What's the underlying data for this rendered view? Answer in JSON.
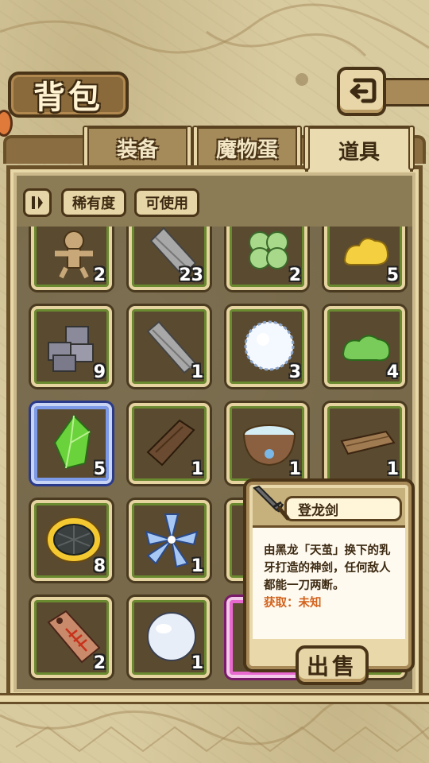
{
  "header": {
    "title": "背包"
  },
  "tabs": [
    {
      "label": "装备",
      "active": false
    },
    {
      "label": "魔物蛋",
      "active": false
    },
    {
      "label": "道具",
      "active": true
    }
  ],
  "filters": {
    "sort_icon": "sort-icon",
    "rarity_label": "稀有度",
    "usable_label": "可使用"
  },
  "items": [
    {
      "icon": "voodoo-doll-icon",
      "count": "2"
    },
    {
      "icon": "stone-slab-icon",
      "count": "23"
    },
    {
      "icon": "four-leaf-clover-icon",
      "count": "2"
    },
    {
      "icon": "gold-nugget-icon",
      "count": "5"
    },
    {
      "icon": "stone-blocks-icon",
      "count": "9"
    },
    {
      "icon": "stone-slab-icon",
      "count": "1"
    },
    {
      "icon": "snowball-icon",
      "count": "3"
    },
    {
      "icon": "green-slime-icon",
      "count": "4"
    },
    {
      "icon": "green-crystal-icon",
      "count": "5"
    },
    {
      "icon": "wood-plank-dark-icon",
      "count": "1"
    },
    {
      "icon": "water-bowl-icon",
      "count": "1"
    },
    {
      "icon": "wood-plank-light-icon",
      "count": "1"
    },
    {
      "icon": "woven-nest-icon",
      "count": "8"
    },
    {
      "icon": "ice-flower-icon",
      "count": "1"
    },
    {
      "icon": "blue-item-icon",
      "count": ""
    },
    {
      "icon": "empty",
      "count": ""
    },
    {
      "icon": "fossil-tag-icon",
      "count": "2"
    },
    {
      "icon": "pearl-icon",
      "count": "1"
    },
    {
      "icon": "sword-item-icon",
      "count": ""
    },
    {
      "icon": "empty",
      "count": ""
    }
  ],
  "tooltip": {
    "name": "登龙剑",
    "description": "由黑龙「天茧」换下的乳牙打造的神剑，任何敌人都能一刀两断。",
    "source": "获取：未知",
    "sell_label": "出售"
  },
  "colors": {
    "panel_bg": "#77694a",
    "slot_border": "#e5d3a0",
    "rare_border": "#7d9ae8",
    "epic_border": "#e86ad0",
    "source_text": "#d2621c"
  }
}
